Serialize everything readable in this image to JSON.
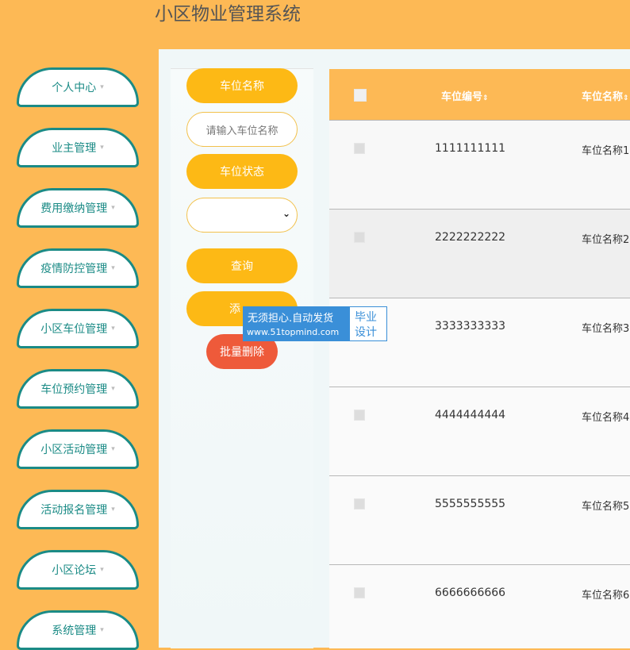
{
  "header": {
    "title": "小区物业管理系统"
  },
  "sidebar": {
    "caret_glyph": "▾",
    "items": [
      {
        "label": "个人中心"
      },
      {
        "label": "业主管理"
      },
      {
        "label": "费用缴纳管理"
      },
      {
        "label": "疫情防控管理"
      },
      {
        "label": "小区车位管理"
      },
      {
        "label": "车位预约管理"
      },
      {
        "label": "小区活动管理"
      },
      {
        "label": "活动报名管理"
      },
      {
        "label": "小区论坛"
      },
      {
        "label": "系统管理"
      }
    ]
  },
  "filter": {
    "name_label": "车位名称",
    "name_placeholder": "请输入车位名称",
    "status_label": "车位状态",
    "status_value": "",
    "search_button": "查询",
    "add_button": "添",
    "batch_delete_button": "批量删除"
  },
  "table": {
    "columns": {
      "number": "车位编号",
      "name": "车位名称",
      "sort_glyph": "⇕"
    },
    "rows": [
      {
        "number": "1111111111",
        "name": "车位名称1"
      },
      {
        "number": "2222222222",
        "name": "车位名称2"
      },
      {
        "number": "3333333333",
        "name": "车位名称3"
      },
      {
        "number": "4444444444",
        "name": "车位名称4"
      },
      {
        "number": "5555555555",
        "name": "车位名称5"
      },
      {
        "number": "6666666666",
        "name": "车位名称6"
      }
    ]
  },
  "watermark": {
    "line1": "无须担心.自动发货",
    "line2": "www.51topmind.com",
    "right1": "毕业",
    "right2": "设计"
  },
  "colors": {
    "accent": "#fdb955",
    "button": "#fdb915",
    "nav_border": "#1b8b86",
    "delete": "#ee5a3a",
    "watermark": "#3a8fd8"
  }
}
